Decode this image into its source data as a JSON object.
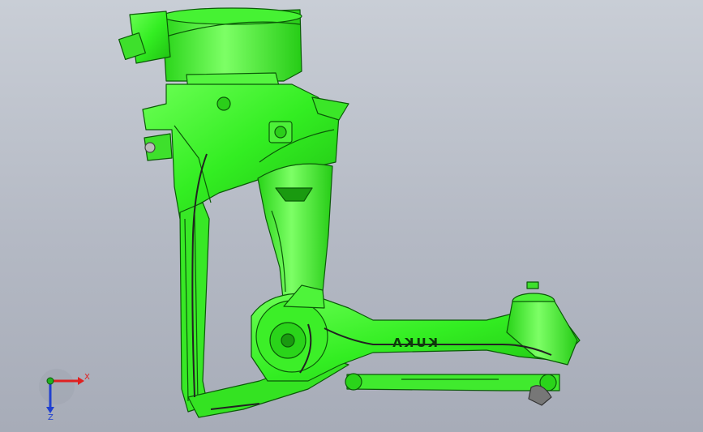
{
  "viewport": {
    "model_color": "#33ee22",
    "model_color_dark": "#0b6e08",
    "background_top": "#c9ced6",
    "background_bottom": "#a7acb8"
  },
  "model": {
    "brand_text": "KUKA",
    "parts": [
      "base-turret",
      "rotating-column",
      "upper-arm",
      "lower-link",
      "forearm",
      "parallel-link",
      "wrist-head",
      "counterbalance-motor",
      "cable-harness"
    ]
  },
  "triad": {
    "x_label": "X",
    "z_label": "Z",
    "x_color": "#e02020",
    "y_color": "#20b020",
    "z_color": "#2040d0"
  }
}
